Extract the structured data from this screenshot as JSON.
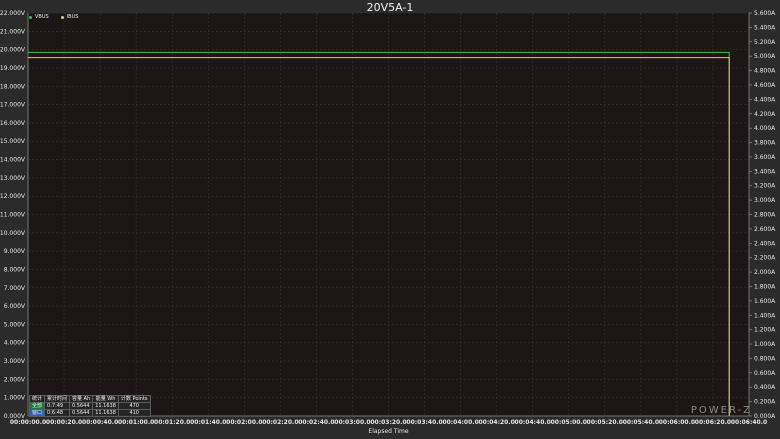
{
  "chart_data": {
    "type": "line",
    "title": "20V5A-1",
    "xlabel": "Elapsed Time",
    "ylabel_left": "",
    "ylabel_right": "",
    "x_unit": "seconds",
    "x_ticks": [
      "00:00:00.0",
      "00:00:20.0",
      "00:00:40.0",
      "00:01:00.0",
      "00:01:20.0",
      "00:01:40.0",
      "00:02:00.0",
      "00:02:20.0",
      "00:02:40.0",
      "00:03:00.0",
      "00:03:20.0",
      "00:03:40.0",
      "00:04:00.0",
      "00:04:20.0",
      "00:04:40.0",
      "00:05:00.0",
      "00:05:20.0",
      "00:05:40.0",
      "00:06:00.0",
      "00:06:20.0",
      "00:06:40.0"
    ],
    "xlim": [
      0,
      400
    ],
    "y_left_ticks": [
      "0.000V",
      "1.000V",
      "2.000V",
      "3.000V",
      "4.000V",
      "5.000V",
      "6.000V",
      "7.000V",
      "8.000V",
      "9.000V",
      "10.000V",
      "11.000V",
      "12.000V",
      "13.000V",
      "14.000V",
      "15.000V",
      "16.000V",
      "17.000V",
      "18.000V",
      "19.000V",
      "20.000V",
      "21.000V",
      "22.000V"
    ],
    "ylim_left": [
      0,
      22
    ],
    "y_right_ticks": [
      "0.000A",
      "0.200A",
      "0.400A",
      "0.600A",
      "0.800A",
      "1.000A",
      "1.200A",
      "1.400A",
      "1.600A",
      "1.800A",
      "2.000A",
      "2.200A",
      "2.400A",
      "2.600A",
      "2.800A",
      "3.000A",
      "3.200A",
      "3.400A",
      "3.600A",
      "3.800A",
      "4.000A",
      "4.200A",
      "4.400A",
      "4.600A",
      "4.800A",
      "5.000A",
      "5.200A",
      "5.400A",
      "5.600A"
    ],
    "ylim_right": [
      0,
      5.6
    ],
    "grid": true,
    "legend": "top-left",
    "series": [
      {
        "name": "VBUS",
        "axis": "left",
        "color": "#3fbf5f",
        "x": [
          0,
          389,
          389
        ],
        "y": [
          19.85,
          19.85,
          0
        ]
      },
      {
        "name": "IBUS",
        "axis": "right",
        "color": "#e8c49a",
        "x": [
          0,
          389,
          389
        ],
        "y": [
          4.98,
          4.98,
          0
        ]
      }
    ]
  },
  "stats": {
    "headers": [
      "统计",
      "累计时间",
      "容量 Ah",
      "能量 Wh",
      "计数 Points"
    ],
    "rows": [
      {
        "label": "全部",
        "time": "0:7:49",
        "ah": "0.5644",
        "wh": "11.1638",
        "points": "470"
      },
      {
        "label": "窗口",
        "time": "0:6:48",
        "ah": "0.5644",
        "wh": "11.1638",
        "points": "410"
      }
    ]
  },
  "brand": "POWER-Z"
}
